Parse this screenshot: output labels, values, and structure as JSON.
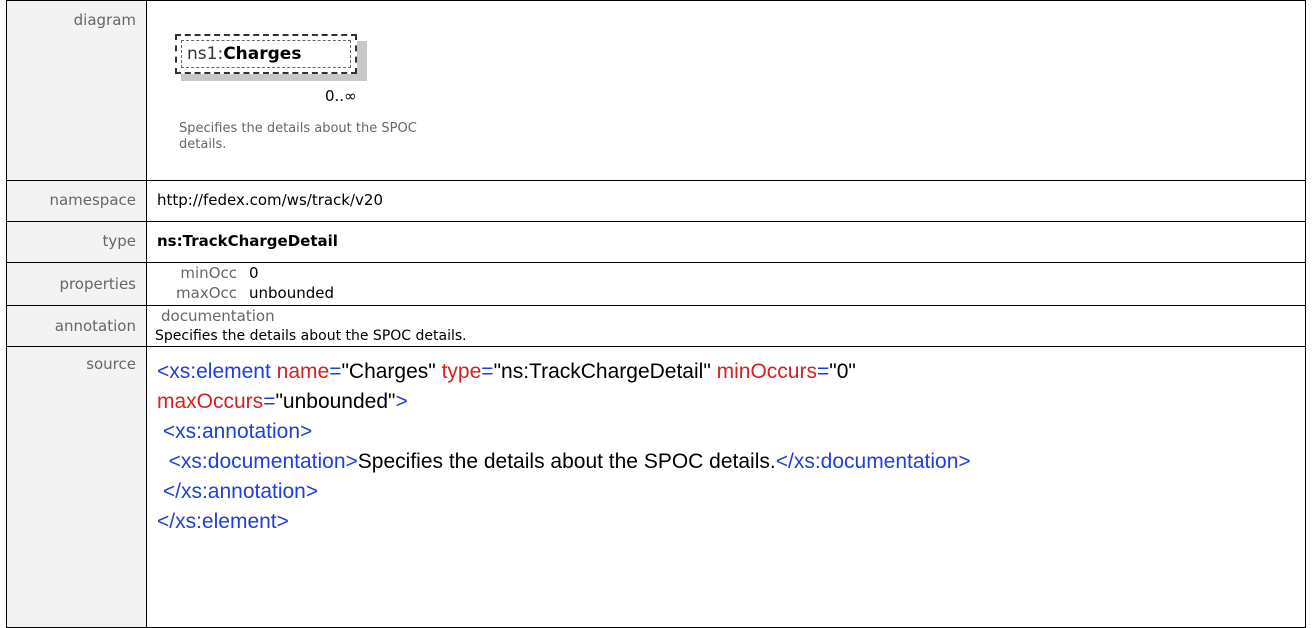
{
  "rows": {
    "diagram": {
      "label": "diagram",
      "element_prefix": "ns1:",
      "element_name": "Charges",
      "occurrence": "0..∞",
      "documentation": "Specifies the details about the SPOC details."
    },
    "namespace": {
      "label": "namespace",
      "value": "http://fedex.com/ws/track/v20"
    },
    "type": {
      "label": "type",
      "value": "ns:TrackChargeDetail"
    },
    "properties": {
      "label": "properties",
      "minOcc_key": "minOcc",
      "minOcc_value": "0",
      "maxOcc_key": "maxOcc",
      "maxOcc_value": "unbounded"
    },
    "annotation": {
      "label": "annotation",
      "key": "documentation",
      "value": "Specifies the details about the SPOC details."
    },
    "source": {
      "label": "source",
      "line1_open": "<xs:element",
      "attr_name": "name",
      "val_name": "\"Charges\"",
      "attr_type": "type",
      "val_type": "\"ns:TrackChargeDetail\"",
      "attr_minOccurs": "minOccurs",
      "val_minOccurs": "\"0\"",
      "attr_maxOccurs": "maxOccurs",
      "val_maxOccurs": "\"unbounded\"",
      "close_bracket": ">",
      "annotation_open": "<xs:annotation>",
      "documentation_open_tag": "<xs:documentation",
      "documentation_text": "Specifies the details about the SPOC details.",
      "documentation_close": "</xs:documentation>",
      "annotation_close": "</xs:annotation>",
      "element_close": "</xs:element>"
    }
  }
}
